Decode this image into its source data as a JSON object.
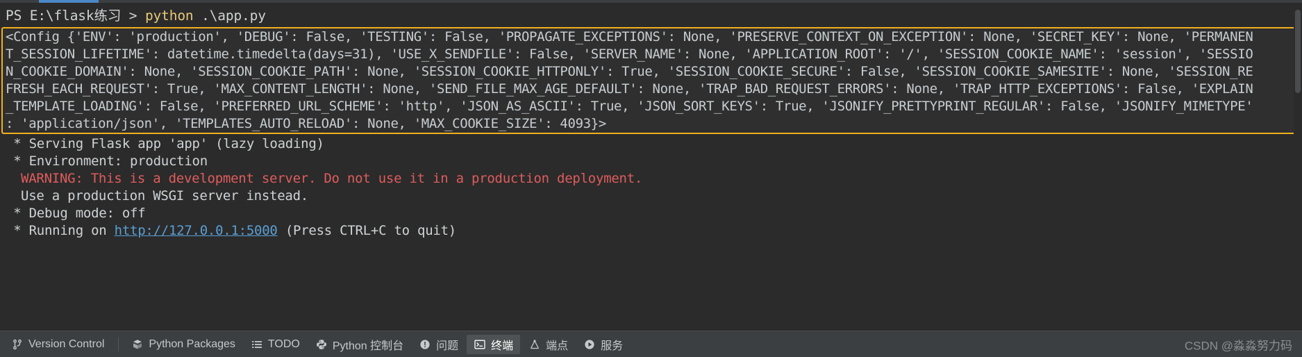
{
  "terminal": {
    "prompt": {
      "ps": "PS E:\\flask练习 > ",
      "command": "python",
      "args": " .\\app.py"
    },
    "config_block": {
      "highlight_color": "#f2b01e",
      "lines": [
        "<Config {'ENV': 'production', 'DEBUG': False, 'TESTING': False, 'PROPAGATE_EXCEPTIONS': None, 'PRESERVE_CONTEXT_ON_EXCEPTION': None, 'SECRET_KEY': None, 'PERMANEN",
        "T_SESSION_LIFETIME': datetime.timedelta(days=31), 'USE_X_SENDFILE': False, 'SERVER_NAME': None, 'APPLICATION_ROOT': '/', 'SESSION_COOKIE_NAME': 'session', 'SESSIO",
        "N_COOKIE_DOMAIN': None, 'SESSION_COOKIE_PATH': None, 'SESSION_COOKIE_HTTPONLY': True, 'SESSION_COOKIE_SECURE': False, 'SESSION_COOKIE_SAMESITE': None, 'SESSION_RE",
        "FRESH_EACH_REQUEST': True, 'MAX_CONTENT_LENGTH': None, 'SEND_FILE_MAX_AGE_DEFAULT': None, 'TRAP_BAD_REQUEST_ERRORS': None, 'TRAP_HTTP_EXCEPTIONS': False, 'EXPLAIN",
        "_TEMPLATE_LOADING': False, 'PREFERRED_URL_SCHEME': 'http', 'JSON_AS_ASCII': True, 'JSON_SORT_KEYS': True, 'JSONIFY_PRETTYPRINT_REGULAR': False, 'JSONIFY_MIMETYPE'",
        ": 'application/json', 'TEMPLATES_AUTO_RELOAD': None, 'MAX_COOKIE_SIZE': 4093}>"
      ]
    },
    "output": {
      "serving": " * Serving Flask app 'app' (lazy loading)",
      "environment": " * Environment: production",
      "warning": "WARNING: This is a development server. Do not use it in a production deployment.",
      "use_wsgi": "Use a production WSGI server instead.",
      "debug_mode": " * Debug mode: off",
      "running_prefix": " * Running on ",
      "running_url": "http://127.0.0.1:5000",
      "running_suffix": " (Press CTRL+C to quit)"
    }
  },
  "toolbar": {
    "items": [
      {
        "label": "Version Control",
        "icon": "branch-icon",
        "active": false
      },
      {
        "label": "Python Packages",
        "icon": "packages-icon",
        "active": false
      },
      {
        "label": "TODO",
        "icon": "list-icon",
        "active": false
      },
      {
        "label": "Python 控制台",
        "icon": "python-console-icon",
        "active": false
      },
      {
        "label": "问题",
        "icon": "problems-icon",
        "active": false
      },
      {
        "label": "终端",
        "icon": "terminal-icon",
        "active": true
      },
      {
        "label": "端点",
        "icon": "endpoints-icon",
        "active": false
      },
      {
        "label": "服务",
        "icon": "services-icon",
        "active": false
      }
    ],
    "watermark": "CSDN @淼淼努力码"
  }
}
